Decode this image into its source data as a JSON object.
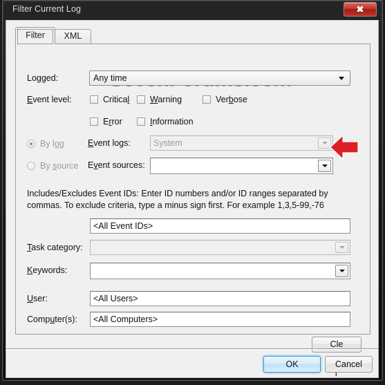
{
  "window": {
    "title": "Filter Current Log",
    "close_label": "✖"
  },
  "tabs": [
    {
      "label": "Filter",
      "active": true
    },
    {
      "label": "XML",
      "active": false
    }
  ],
  "watermark": "SevenForums.com",
  "form": {
    "logged": {
      "label": "Logged:",
      "value": "Any time"
    },
    "event_level": {
      "label": "Event level:",
      "options": [
        {
          "label": "Critical",
          "checked": false
        },
        {
          "label": "Warning",
          "checked": false
        },
        {
          "label": "Verbose",
          "checked": false
        },
        {
          "label": "Error",
          "checked": false
        },
        {
          "label": "Information",
          "checked": false
        }
      ]
    },
    "source_mode": {
      "by_log": {
        "label": "By log",
        "selected": true,
        "enabled": false
      },
      "by_source": {
        "label": "By source",
        "selected": false,
        "enabled": false
      }
    },
    "event_logs": {
      "label": "Event logs:",
      "value": "System",
      "enabled": false
    },
    "event_sources": {
      "label": "Event sources:",
      "value": "",
      "enabled": true
    },
    "help_text": "Includes/Excludes Event IDs: Enter ID numbers and/or ID ranges separated by commas. To exclude criteria, type a minus sign first. For example 1,3,5-99,-76",
    "event_ids": {
      "value": "<All Event IDs>"
    },
    "task_category": {
      "label": "Task category:",
      "value": "",
      "enabled": false
    },
    "keywords": {
      "label": "Keywords:",
      "value": "",
      "enabled": true
    },
    "user": {
      "label": "User:",
      "value": "<All Users>"
    },
    "computers": {
      "label": "Computer(s):",
      "value": "<All Computers>"
    },
    "clear_button": "Clear"
  },
  "footer": {
    "ok": "OK",
    "cancel": "Cancel"
  },
  "annotation": {
    "arrow_color": "#dd1f26",
    "points_to": "event-sources-dropdown"
  },
  "colors": {
    "titlebar": "#1a1a1a",
    "dialog_bg": "#f0f0f0",
    "close_red": "#c9352a",
    "default_button_blue": "#3c9ad4",
    "watermark_gray": "#8d8d8d"
  }
}
